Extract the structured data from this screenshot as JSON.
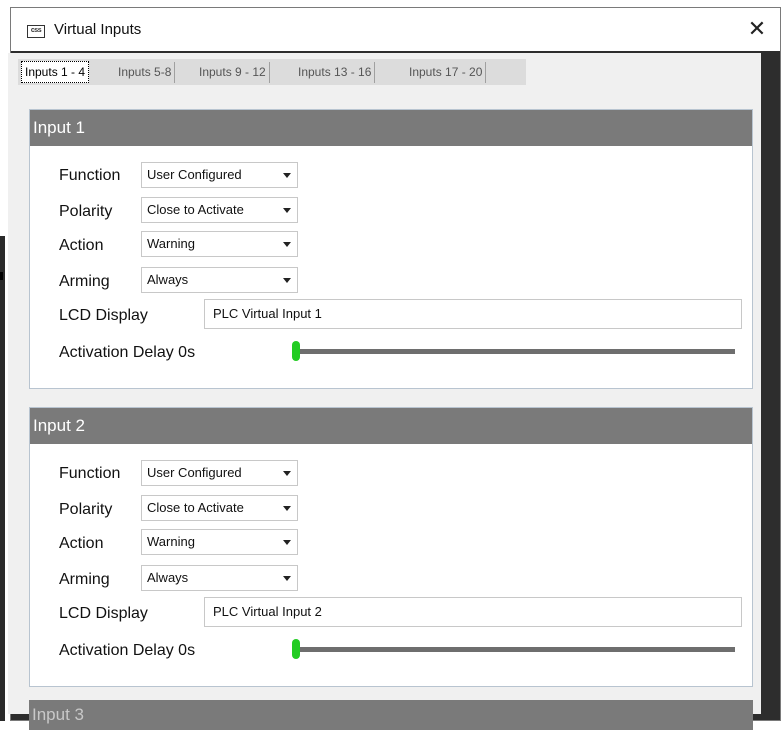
{
  "window": {
    "title": "Virtual Inputs",
    "app_icon_text": "css",
    "close_glyph": "✕"
  },
  "tabs": [
    {
      "label": "Inputs 1 - 4",
      "active": true
    },
    {
      "label": "Inputs 5-8",
      "active": false
    },
    {
      "label": "Inputs 9 - 12",
      "active": false
    },
    {
      "label": "Inputs 13 - 16",
      "active": false
    },
    {
      "label": "Inputs 17 - 20",
      "active": false
    }
  ],
  "labels": {
    "function": "Function",
    "polarity": "Polarity",
    "action": "Action",
    "arming": "Arming",
    "lcd_display": "LCD Display",
    "activation_delay": "Activation Delay"
  },
  "inputs": [
    {
      "header": "Input 1",
      "function": "User Configured",
      "polarity": "Close to Activate",
      "action": "Warning",
      "arming": "Always",
      "lcd_display": "PLC Virtual Input 1",
      "activation_delay": "0s",
      "delay_fraction": 0
    },
    {
      "header": "Input 2",
      "function": "User Configured",
      "polarity": "Close to Activate",
      "action": "Warning",
      "arming": "Always",
      "lcd_display": "PLC Virtual Input 2",
      "activation_delay": "0s",
      "delay_fraction": 0
    },
    {
      "header": "Input 3"
    }
  ],
  "colors": {
    "slider_thumb": "#22cc22",
    "panel_header": "#7a7a7a"
  },
  "icons": [
    "app-icon",
    "close-icon",
    "dropdown-arrow-icon"
  ]
}
